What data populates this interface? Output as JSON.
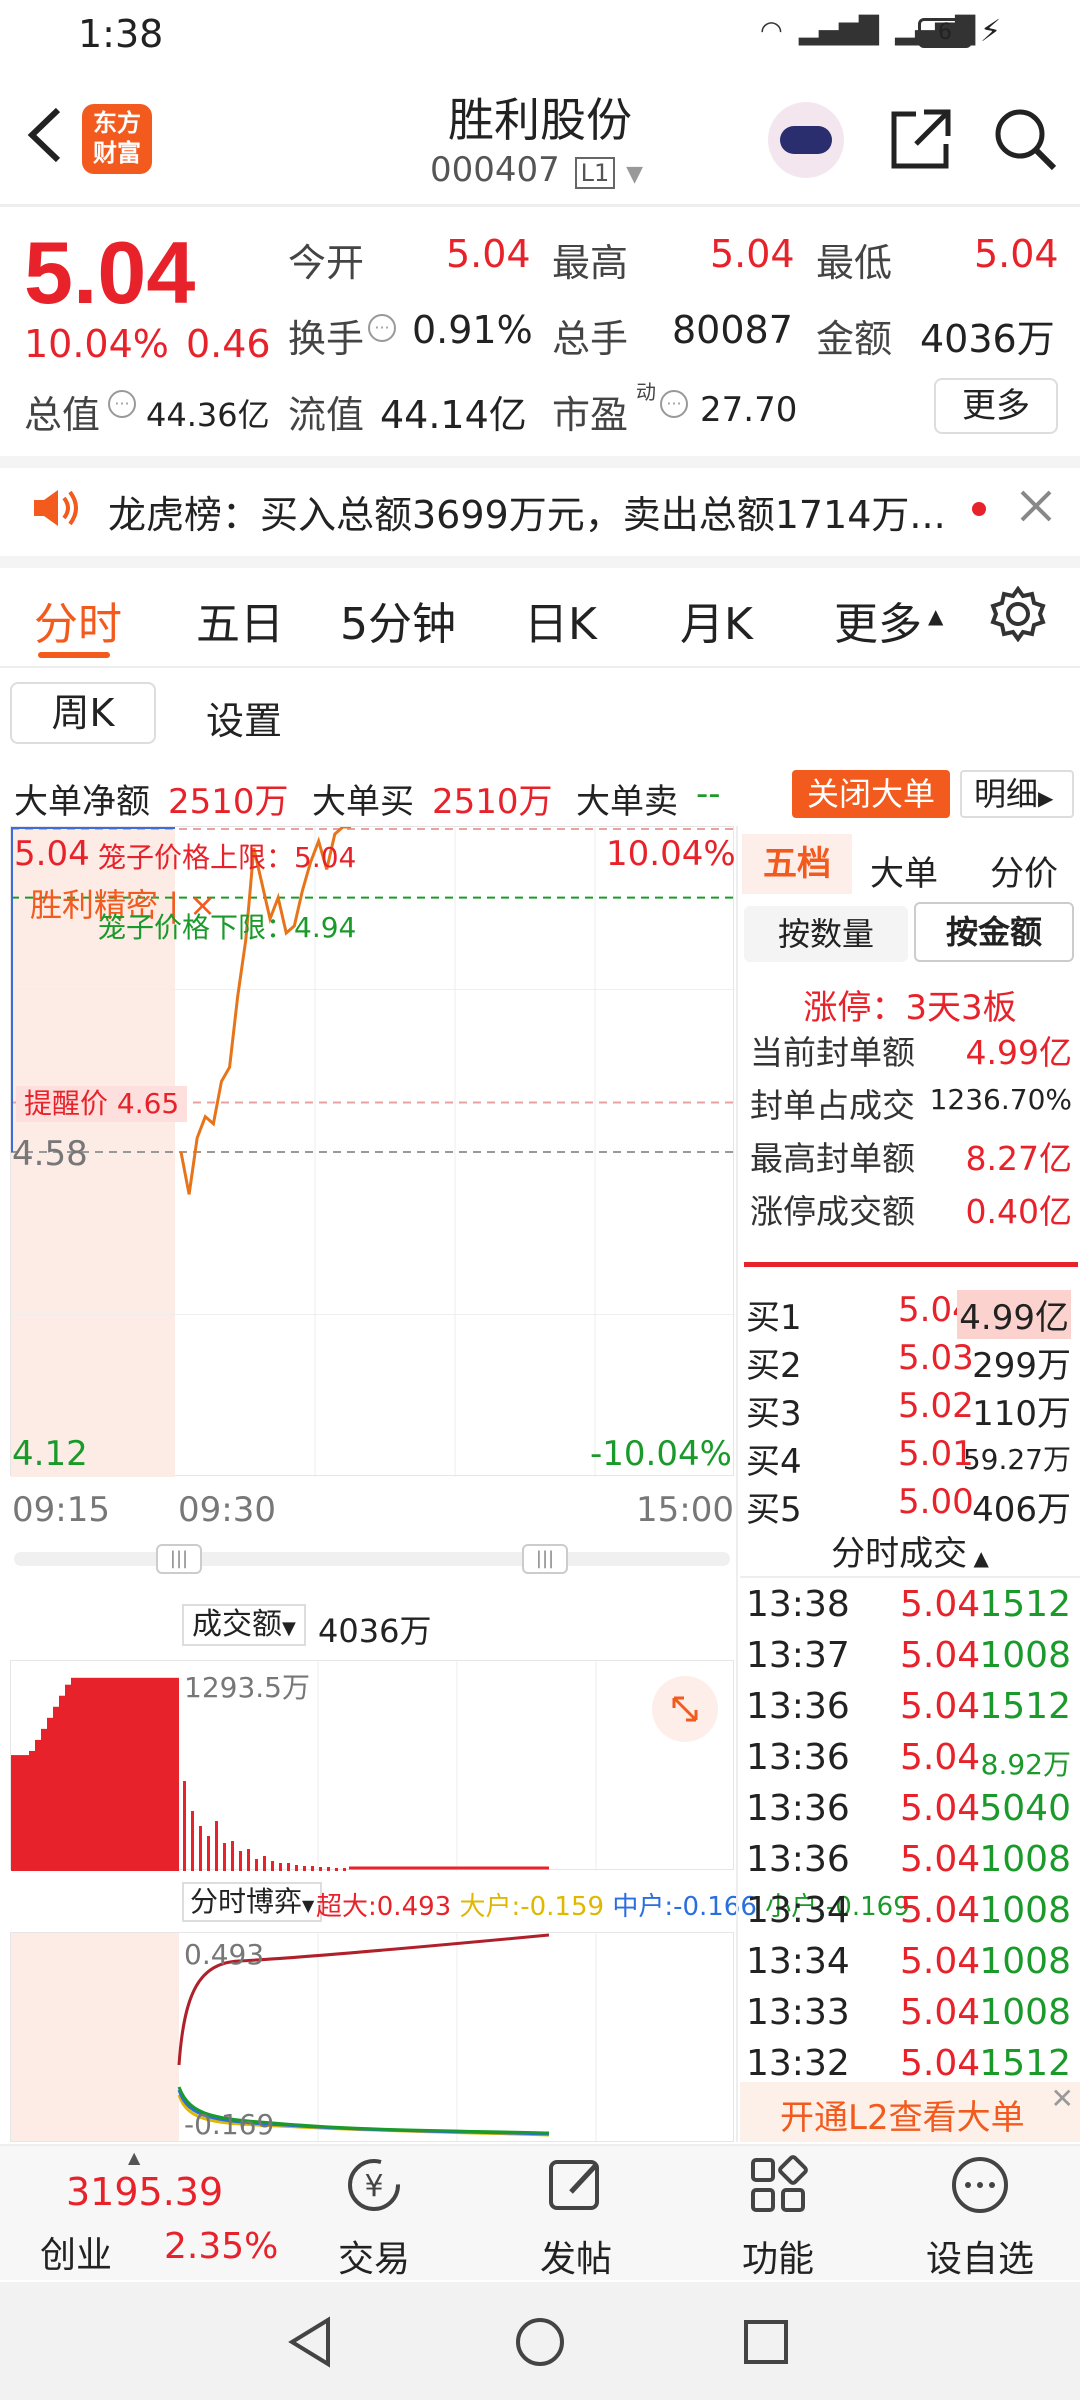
{
  "status_bar": {
    "time": "1:38",
    "battery": "6"
  },
  "header": {
    "title": "胜利股份",
    "code": "000407",
    "level": "L1",
    "logo_line1": "东方",
    "logo_line2": "财富"
  },
  "quote": {
    "price": "5.04",
    "change_pct": "10.04%",
    "change": "0.46",
    "open_label": "今开",
    "open": "5.04",
    "high_label": "最高",
    "high": "5.04",
    "low_label": "最低",
    "low": "5.04",
    "turnover_label": "换手",
    "turnover": "0.91%",
    "volume_label": "总手",
    "volume": "80087",
    "amount_label": "金额",
    "amount": "4036万",
    "mcap_label": "总值",
    "mcap": "44.36亿",
    "float_label": "流值",
    "float": "44.14亿",
    "pe_label": "市盈",
    "pe_sup": "动",
    "pe": "27.70",
    "more": "更多"
  },
  "notice": {
    "text": "龙虎榜：买入总额3699万元，卖出总额1714万..."
  },
  "tabs": [
    "分时",
    "五日",
    "5分钟",
    "日K",
    "月K",
    "更多"
  ],
  "subtabs": [
    "周K",
    "设置"
  ],
  "bigorder": {
    "net_label": "大单净额",
    "net": "2510万",
    "buy_label": "大单买",
    "buy": "2510万",
    "sell_label": "大单卖",
    "sell": "--",
    "close_btn": "关闭大单",
    "detail_btn": "明细"
  },
  "chart": {
    "top_price": "5.04",
    "top_pct": "10.04%",
    "bottom_price": "4.12",
    "bottom_pct": "-10.04%",
    "mid_price": "4.58",
    "cage_upper": "笼子价格上限：5.04",
    "cage_lower": "笼子价格下限：4.94",
    "alert": "提醒价 4.65",
    "tag": "胜利精密",
    "time_start": "09:15",
    "time_mid": "09:30",
    "time_end": "15:00"
  },
  "chart_data": {
    "type": "line",
    "xlabel": "",
    "ylabel": "",
    "ylim": [
      4.12,
      5.04
    ],
    "x": [
      "09:31",
      "09:32",
      "09:34",
      "09:36",
      "09:38",
      "09:40",
      "09:42",
      "09:44",
      "09:46",
      "09:48",
      "09:50",
      "09:52",
      "09:54",
      "09:56",
      "09:58",
      "10:00",
      "10:02",
      "10:04",
      "10:06",
      "10:08",
      "10:10",
      "10:12"
    ],
    "series": [
      {
        "values": [
          4.58,
          4.52,
          4.6,
          4.63,
          4.62,
          4.68,
          4.7,
          4.8,
          4.88,
          5.01,
          4.96,
          4.91,
          4.94,
          4.89,
          4.9,
          4.95,
          4.99,
          5.02,
          4.98,
          5.03,
          5.04,
          5.04
        ]
      }
    ]
  },
  "volume": {
    "label": "成交额",
    "value": "4036万",
    "axis": "1293.5万"
  },
  "flow": {
    "label": "分时博弈",
    "super": "超大:0.493",
    "large": "大户:-0.159",
    "mid": "中户:-0.166",
    "small": "小户:-0.169",
    "top": "0.493",
    "bottom": "-0.169"
  },
  "right": {
    "tabs": [
      "五档",
      "大单",
      "分价"
    ],
    "btn_qty": "按数量",
    "btn_amt": "按金额",
    "limit": "涨停：3天3板",
    "stats": [
      {
        "k": "当前封单额",
        "v": "4.99亿"
      },
      {
        "k": "封单占成交",
        "v": "1236.70%"
      },
      {
        "k": "最高封单额",
        "v": "8.27亿"
      },
      {
        "k": "涨停成交额",
        "v": "0.40亿"
      }
    ],
    "book": [
      {
        "k": "买1",
        "p": "5.04",
        "v": "4.99亿"
      },
      {
        "k": "买2",
        "p": "5.03",
        "v": "299万"
      },
      {
        "k": "买3",
        "p": "5.02",
        "v": "110万"
      },
      {
        "k": "买4",
        "p": "5.01",
        "v": "59.27万"
      },
      {
        "k": "买5",
        "p": "5.00",
        "v": "406万"
      }
    ],
    "ticks_title": "分时成交",
    "ticks": [
      {
        "t": "13:38",
        "p": "5.04",
        "v": "1512"
      },
      {
        "t": "13:37",
        "p": "5.04",
        "v": "1008"
      },
      {
        "t": "13:36",
        "p": "5.04",
        "v": "1512"
      },
      {
        "t": "13:36",
        "p": "5.04",
        "v": "8.92万"
      },
      {
        "t": "13:36",
        "p": "5.04",
        "v": "5040"
      },
      {
        "t": "13:36",
        "p": "5.04",
        "v": "1008"
      },
      {
        "t": "13:34",
        "p": "5.04",
        "v": "1008"
      },
      {
        "t": "13:34",
        "p": "5.04",
        "v": "1008"
      },
      {
        "t": "13:33",
        "p": "5.04",
        "v": "1008"
      },
      {
        "t": "13:32",
        "p": "5.04",
        "v": "1512"
      }
    ],
    "l2": "开通L2查看大单"
  },
  "bottom": {
    "index_value": "3195.39",
    "index_name": "创业",
    "index_pct": "2.35%",
    "nav": [
      "交易",
      "发帖",
      "功能",
      "设自选"
    ]
  }
}
